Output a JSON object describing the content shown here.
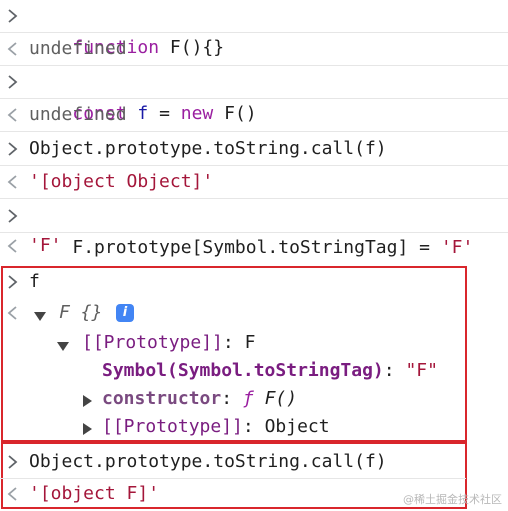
{
  "console": {
    "entries": [
      {
        "type": "input",
        "parts": [
          [
            "kw",
            "function"
          ],
          [
            "plain",
            " F(){}"
          ]
        ]
      },
      {
        "type": "output",
        "text": "undefined"
      },
      {
        "type": "input",
        "parts": [
          [
            "kw",
            "const"
          ],
          [
            "plain",
            " "
          ],
          [
            "ident",
            "f"
          ],
          [
            "plain",
            " = "
          ],
          [
            "kw",
            "new"
          ],
          [
            "plain",
            " F()"
          ]
        ]
      },
      {
        "type": "output",
        "text": "undefined"
      },
      {
        "type": "input",
        "text": "Object.prototype.toString.call(f)"
      },
      {
        "type": "output_str",
        "text": "'[object Object]'"
      },
      {
        "type": "input",
        "parts": [
          [
            "plain",
            "F.prototype[Symbol.toStringTag] = "
          ],
          [
            "str",
            "'F'"
          ]
        ]
      },
      {
        "type": "output_str",
        "text": "'F'"
      }
    ],
    "highlight_block": {
      "input": "f",
      "object_label": "F {}",
      "info_icon": "i",
      "prototype_label": "[[Prototype]]",
      "prototype_value": ": F",
      "symbol_key": "Symbol(Symbol.toStringTag)",
      "symbol_colon": ": ",
      "symbol_value": "\"F\"",
      "constructor_key": "constructor",
      "constructor_colon": ": ",
      "constructor_fn": "ƒ",
      "constructor_value": " F()",
      "inner_prototype_label": "[[Prototype]]",
      "inner_prototype_value": ": Object"
    },
    "final_block": {
      "input": "Object.prototype.toString.call(f)",
      "output": "'[object F]'"
    }
  },
  "watermark": "@稀土掘金技术社区",
  "colors": {
    "keyword": "#9a1fa0",
    "string": "#a4163a",
    "highlight_border": "#d9262c",
    "info_badge": "#4285f4"
  }
}
